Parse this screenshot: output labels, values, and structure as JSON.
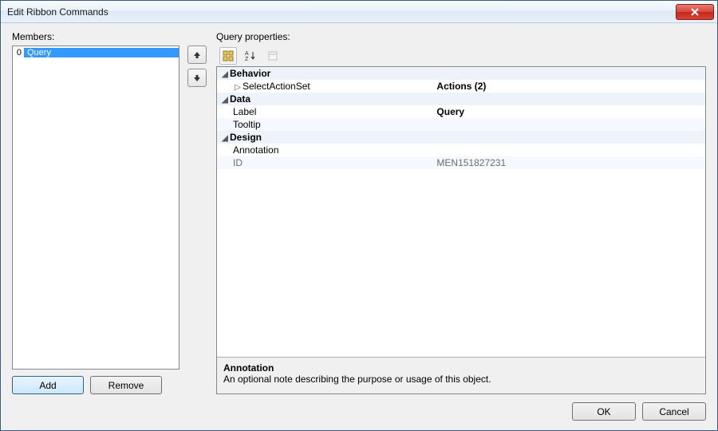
{
  "window": {
    "title": "Edit Ribbon Commands"
  },
  "members": {
    "label": "Members:",
    "items": [
      {
        "index": "0",
        "label": "Query"
      }
    ],
    "add_label": "Add",
    "remove_label": "Remove"
  },
  "reorder": {
    "up_icon": "arrow-up",
    "down_icon": "arrow-down"
  },
  "props": {
    "label": "Query properties:",
    "toolbar": {
      "categorized_icon": "categorized",
      "alphabetical_icon": "sort-az",
      "pages_icon": "property-pages"
    },
    "categories": [
      {
        "name": "Behavior",
        "expanded": true,
        "rows": [
          {
            "name": "SelectActionSet",
            "value": "Actions (2)",
            "bold": true,
            "expander": ">"
          }
        ]
      },
      {
        "name": "Data",
        "expanded": true,
        "rows": [
          {
            "name": "Label",
            "value": "Query",
            "bold": true
          },
          {
            "name": "Tooltip",
            "value": "",
            "bold": false
          }
        ]
      },
      {
        "name": "Design",
        "expanded": true,
        "rows": [
          {
            "name": "Annotation",
            "value": "",
            "bold": false
          },
          {
            "name": "ID",
            "value": "MEN151827231",
            "bold": false,
            "muted": true
          }
        ]
      }
    ],
    "description": {
      "title": "Annotation",
      "text": "An optional note describing the purpose or usage of this object."
    }
  },
  "footer": {
    "ok_label": "OK",
    "cancel_label": "Cancel"
  }
}
